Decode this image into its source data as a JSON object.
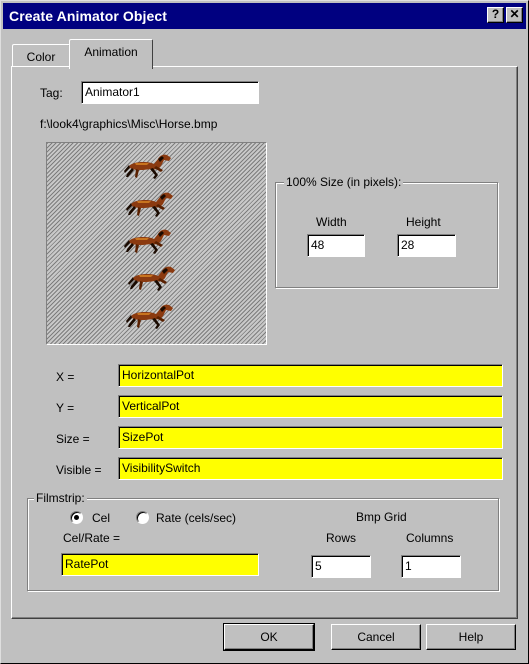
{
  "window": {
    "title": "Create Animator Object",
    "help_glyph": "?",
    "close_glyph": "✕"
  },
  "tabs": [
    {
      "label": "Color",
      "selected": false
    },
    {
      "label": "Animation",
      "selected": true
    }
  ],
  "tag": {
    "label": "Tag:",
    "value": "Animator1"
  },
  "file_path": "f:\\look4\\graphics\\Misc\\Horse.bmp",
  "size_group": {
    "title": "100% Size (in pixels):",
    "width_label": "Width",
    "height_label": "Height",
    "width_value": "48",
    "height_value": "28"
  },
  "bindings": {
    "x_label": "X =",
    "x_value": "HorizontalPot",
    "y_label": "Y =",
    "y_value": "VerticalPot",
    "size_label": "Size =",
    "size_value": "SizePot",
    "visible_label": "Visible =",
    "visible_value": "VisibilitySwitch"
  },
  "filmstrip": {
    "title": "Filmstrip:",
    "cel_label": "Cel",
    "rate_label": "Rate (cels/sec)",
    "selected_option": "Cel",
    "celrate_label": "Cel/Rate =",
    "celrate_value": "RatePot",
    "bmp_grid_label": "Bmp Grid",
    "rows_label": "Rows",
    "columns_label": "Columns",
    "rows_value": "5",
    "columns_value": "1"
  },
  "buttons": {
    "ok": "OK",
    "cancel": "Cancel",
    "help": "Help"
  },
  "colors": {
    "field_highlight": "#ffff00",
    "titlebar": "#000080",
    "face": "#c0c0c0",
    "horse": "#8b3a10"
  },
  "preview_icon": "horse-icon"
}
